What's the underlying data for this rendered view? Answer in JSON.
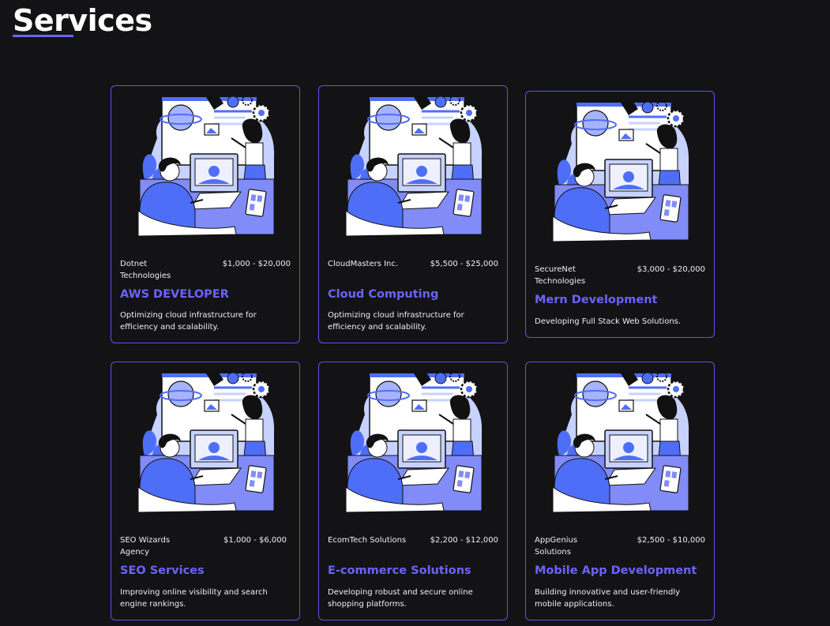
{
  "page": {
    "title": "Services"
  },
  "services": [
    {
      "company": "Dotnet Technologies",
      "price": "$1,000 - $20,000",
      "title": "AWS DEVELOPER",
      "description": "Optimizing cloud infrastructure for efficiency and scalability."
    },
    {
      "company": "CloudMasters Inc.",
      "price": "$5,500 - $25,000",
      "title": "Cloud Computing",
      "description": "Optimizing cloud infrastructure for efficiency and scalability."
    },
    {
      "company": "SecureNet Technologies",
      "price": "$3,000 - $20,000",
      "title": "Mern Development",
      "description": "Developing Full Stack Web Solutions."
    },
    {
      "company": "SEO Wizards Agency",
      "price": "$1,000 - $6,000",
      "title": "SEO Services",
      "description": "Improving online visibility and search engine rankings."
    },
    {
      "company": "EcomTech Solutions",
      "price": "$2,200 - $12,000",
      "title": "E-commerce Solutions",
      "description": "Developing robust and secure online shopping platforms."
    },
    {
      "company": "AppGenius Solutions",
      "price": "$2,500 - $10,000",
      "title": "Mobile App Development",
      "description": "Building innovative and user-friendly mobile applications."
    }
  ],
  "colors": {
    "accent": "#6c63ff",
    "background": "#131315",
    "illustration_blue": "#4f6ef7",
    "illustration_light": "#c7d2fe"
  },
  "icons": {
    "card_image": "developer-illustration"
  }
}
